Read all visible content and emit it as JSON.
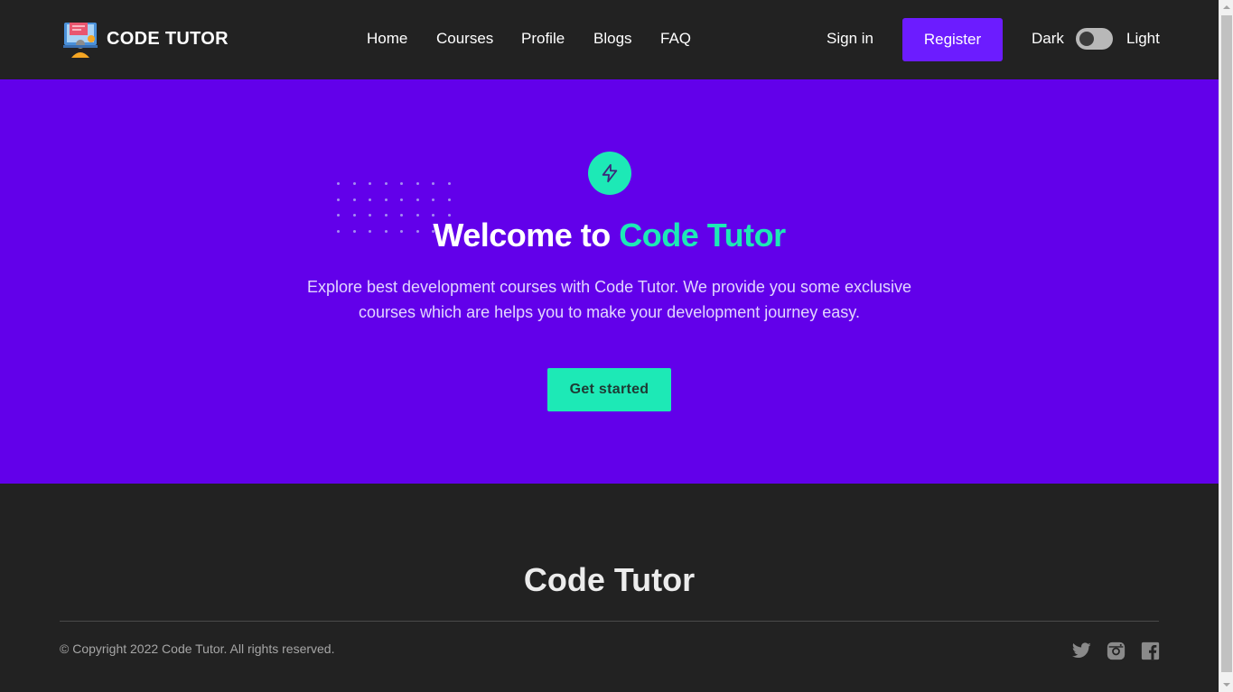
{
  "brand": {
    "name": "CODE TUTOR",
    "logo_icon": "computer-tutor-logo"
  },
  "nav": {
    "items": [
      {
        "label": "Home"
      },
      {
        "label": "Courses"
      },
      {
        "label": "Profile"
      },
      {
        "label": "Blogs"
      },
      {
        "label": "FAQ"
      }
    ]
  },
  "auth": {
    "signin_label": "Sign in",
    "register_label": "Register"
  },
  "theme": {
    "dark_label": "Dark",
    "light_label": "Light",
    "mode": "dark"
  },
  "hero": {
    "icon": "lightning-bolt-icon",
    "title_prefix": "Welcome to ",
    "title_accent": "Code Tutor",
    "description": "Explore best development courses with Code Tutor. We provide you some exclusive courses which are helps you to make your development journey easy.",
    "cta_label": "Get started"
  },
  "footer": {
    "title": "Code Tutor",
    "copyright": "© Copyright 2022 Code Tutor. All rights reserved.",
    "social": [
      "twitter-icon",
      "instagram-icon",
      "facebook-icon"
    ]
  },
  "colors": {
    "header_bg": "#222222",
    "hero_bg": "#6200ea",
    "accent": "#1de9b6",
    "register_bg": "#6c1cff"
  }
}
